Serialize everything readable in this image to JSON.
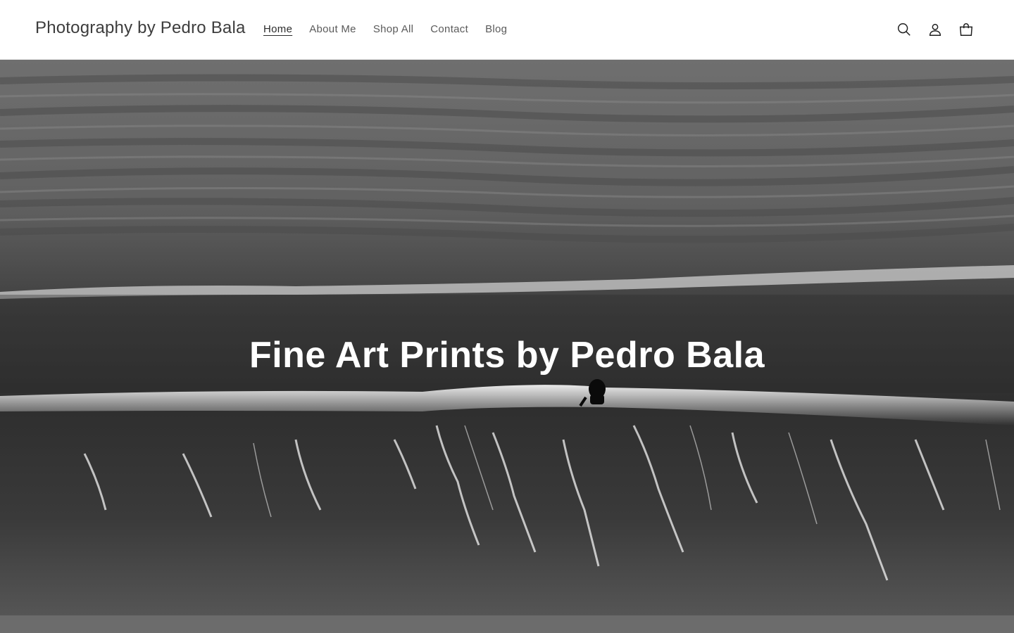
{
  "header": {
    "brand": "Photography by Pedro Bala",
    "nav": [
      {
        "label": "Home",
        "active": true
      },
      {
        "label": "About Me",
        "active": false
      },
      {
        "label": "Shop All",
        "active": false
      },
      {
        "label": "Contact",
        "active": false
      },
      {
        "label": "Blog",
        "active": false
      }
    ],
    "icons": [
      "search-icon",
      "account-icon",
      "cart-icon"
    ]
  },
  "hero": {
    "title": "Fine Art Prints by Pedro Bala",
    "image": "black-and-white-wave-with-surfer"
  },
  "colors": {
    "header_bg": "#ffffff",
    "nav_text": "#5a5a5a",
    "hero_text": "#ffffff"
  }
}
